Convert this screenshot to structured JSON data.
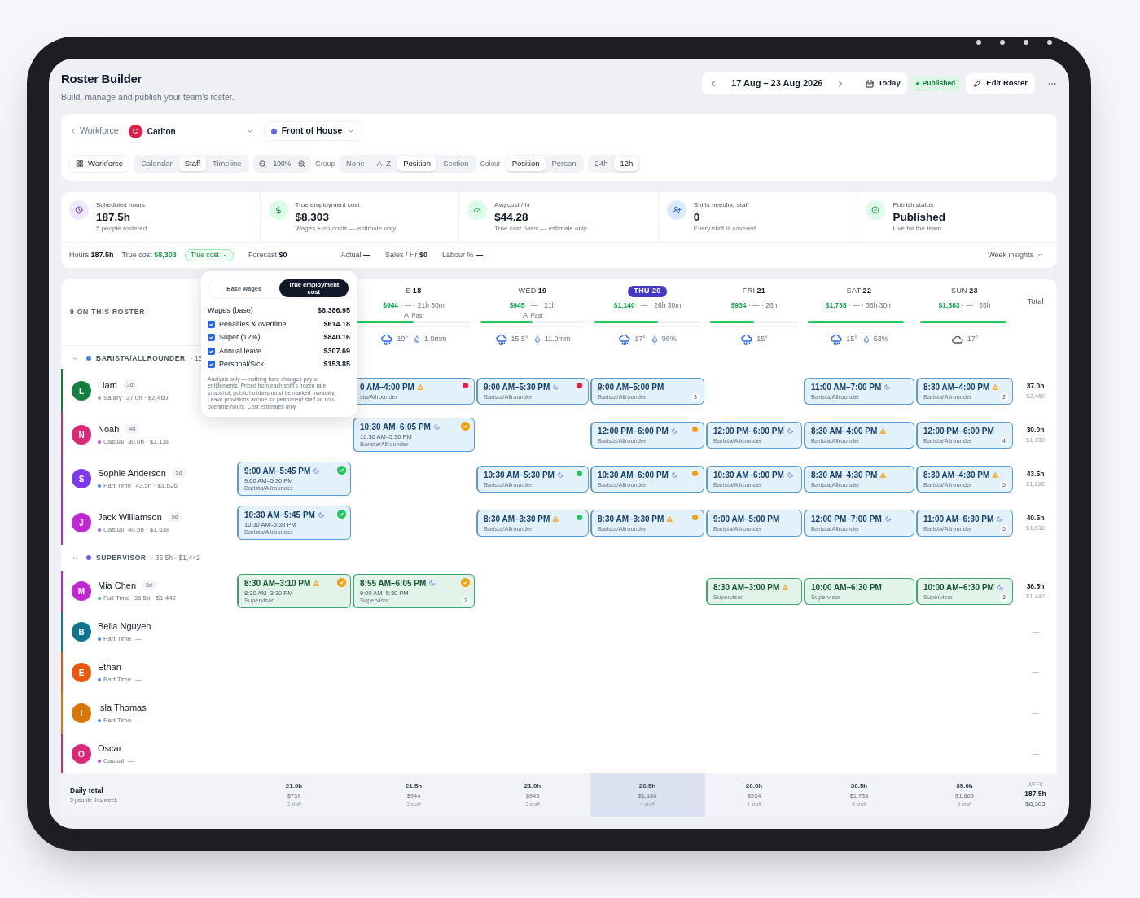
{
  "header": {
    "title": "Roster Builder",
    "subtitle": "Build, manage and publish your team's roster."
  },
  "date_nav": {
    "range": "17 Aug – 23 Aug 2026",
    "today": "Today"
  },
  "status_badge": "Published",
  "edit_button": "Edit Roster",
  "filters": {
    "back_link": "Workforce",
    "location": {
      "initial": "C",
      "name": "Carlton",
      "color": "#e11d48"
    },
    "section": {
      "name": "Front of House",
      "color": "#6366f1"
    },
    "view_button": "Workforce",
    "views": [
      {
        "label": "Calendar",
        "selected": false
      },
      {
        "label": "Staff",
        "selected": true
      },
      {
        "label": "Timeline",
        "selected": false
      }
    ],
    "zoom": "100%",
    "group_label": "Group",
    "group_options": [
      {
        "label": "None",
        "selected": false
      },
      {
        "label": "A–Z",
        "selected": false
      },
      {
        "label": "Position",
        "selected": true
      },
      {
        "label": "Section",
        "selected": false
      }
    ],
    "colour_label": "Colour",
    "colour_options": [
      {
        "label": "Position",
        "selected": true
      },
      {
        "label": "Person",
        "selected": false
      }
    ],
    "clock_options": [
      {
        "label": "24h",
        "selected": false
      },
      {
        "label": "12h",
        "selected": true
      }
    ]
  },
  "stats": [
    {
      "kind": "clock",
      "label": "Scheduled hours",
      "value": "187.5h",
      "note": "5 people rostered"
    },
    {
      "kind": "dollar",
      "label": "True employment cost",
      "value": "$8,303",
      "note": "Wages + on-costs — estimate only"
    },
    {
      "kind": "gauge",
      "label": "Avg cost / hr",
      "value": "$44.28",
      "note": "True cost basis — estimate only"
    },
    {
      "kind": "user",
      "label": "Shifts needing staff",
      "value": "0",
      "note": "Every shift is covered"
    },
    {
      "kind": "check",
      "label": "Publish status",
      "value": "Published",
      "note": "Live for the team"
    }
  ],
  "summary": {
    "hours_label": "Hours",
    "hours": "187.5h",
    "cost_label": "True cost",
    "cost": "$8,303",
    "cost_toggle": {
      "label": "True cost",
      "expanded": true
    },
    "items": [
      {
        "label": "Forecast",
        "value": "$0"
      },
      {
        "label": "Actual",
        "value": "—"
      },
      {
        "label": "Sales / Hr",
        "value": "$0"
      },
      {
        "label": "Labour %",
        "value": "—"
      }
    ],
    "insights": "Week insights"
  },
  "popover": {
    "tabs": [
      {
        "label": "Base wages",
        "selected": false
      },
      {
        "label": "True employment cost",
        "selected": true
      }
    ],
    "lines": [
      {
        "kind": "plain",
        "label": "Wages (base)",
        "value": "$6,386.95"
      },
      {
        "kind": "checkbox",
        "label": "Penalties & overtime",
        "value": "$614.18",
        "checked": true
      },
      {
        "kind": "checkbox",
        "label": "Super (12%)",
        "value": "$840.16",
        "checked": true
      },
      {
        "kind": "checkbox",
        "label": "Annual leave",
        "value": "$307.69",
        "checked": true
      },
      {
        "kind": "checkbox",
        "label": "Personal/Sick",
        "value": "$153.85",
        "checked": true
      }
    ],
    "note": "Analysis only — nothing here changes pay or entitlements. Priced from each shift's frozen rate snapshot; public holidays must be marked manually. Leave provisions accrue for permanent staff on non-overtime hours. Cost estimates only."
  },
  "roster": {
    "count_label": "9 ON THIS ROSTER",
    "total_label": "Total",
    "days": [
      {
        "label": "E",
        "date": "18",
        "cost": "$944",
        "meta": "· — · 21h 30m",
        "past": true,
        "past_label": "Past",
        "level": 0.5,
        "selected": false,
        "weather": {
          "kind": "rain",
          "temp": "19°",
          "precip": "1.9mm"
        }
      },
      {
        "label": "WED",
        "date": "19",
        "cost": "$945",
        "meta": "· — · 21h",
        "past": true,
        "past_label": "Past",
        "level": 0.5,
        "selected": false,
        "weather": {
          "kind": "rain",
          "temp": "15.5°",
          "precip": "11.9mm"
        }
      },
      {
        "label": "THU",
        "date": "20",
        "cost": "$1,140",
        "meta": "· — · 26h 30m",
        "past": false,
        "level": 0.6,
        "selected": true,
        "weather": {
          "kind": "rain",
          "temp": "17°",
          "precip": "96%"
        }
      },
      {
        "label": "FRI",
        "date": "21",
        "cost": "$934",
        "meta": "· — · 26h",
        "past": false,
        "level": 0.5,
        "selected": false,
        "weather": {
          "kind": "rain",
          "temp": "15°"
        }
      },
      {
        "label": "SAT",
        "date": "22",
        "cost": "$1,738",
        "meta": "· — · 36h 30m",
        "past": false,
        "level": 0.94,
        "selected": false,
        "weather": {
          "kind": "rain",
          "temp": "15°",
          "precip": "53%"
        }
      },
      {
        "label": "SUN",
        "date": "23",
        "cost": "$1,863",
        "meta": "· — · 35h",
        "past": false,
        "level": 0.97,
        "selected": false,
        "weather": {
          "kind": "cloud",
          "temp": "17°"
        }
      }
    ],
    "groups": [
      {
        "kind": "barista",
        "name": "BARISTA/ALLROUNDER",
        "meta": "· 15",
        "color": "#3b82f6",
        "expanded": true,
        "staff": [
          {
            "initial": "L",
            "name": "Liam",
            "badge": "3d",
            "color": "#15803d",
            "employment": {
              "type": "Salary",
              "color": "#9ca3af"
            },
            "detail": "37.0h · $2,460",
            "total_hours": "37.0h",
            "total_cost": "$2,460",
            "shifts": [
              {
                "kind": "empty"
              },
              {
                "kind": "early",
                "time": "0 AM–4:00 PM",
                "role": "sta/Allrounder",
                "flag": {
                  "kind": "dot",
                  "color": "#e11d48"
                }
              },
              {
                "kind": "late",
                "time": "9:00 AM–5:30 PM",
                "role": "Barista/Allrounder",
                "flag": {
                  "kind": "dot",
                  "color": "#e11d48"
                }
              },
              {
                "kind": "plain",
                "time": "9:00 AM–5:00 PM",
                "role": "Barista/Allrounder",
                "count": "3"
              },
              {
                "kind": "empty"
              },
              {
                "kind": "late",
                "time": "11:00 AM–7:00 PM",
                "role": "Barista/Allrounder"
              },
              {
                "kind": "early",
                "time": "8:30 AM–4:00 PM",
                "role": "Barista/Allrounder",
                "count": "2"
              }
            ]
          },
          {
            "initial": "N",
            "name": "Noah",
            "badge": "4d",
            "color": "#db2777",
            "employment": {
              "type": "Casual",
              "color": "#a855f7"
            },
            "detail": "30.0h · $1,138",
            "total_hours": "30.0h",
            "total_cost": "$1,138",
            "shifts": [
              {
                "kind": "empty"
              },
              {
                "kind": "late",
                "time": "10:30 AM–6:05 PM",
                "actual": "10:30 AM–5:30 PM",
                "role": "Barista/Allrounder",
                "flag": {
                  "kind": "check",
                  "color": "#f59e0b"
                }
              },
              {
                "kind": "empty"
              },
              {
                "kind": "late",
                "time": "12:00 PM–6:00 PM",
                "role": "Barista/Allrounder",
                "flag": {
                  "kind": "dot",
                  "color": "#f59e0b"
                }
              },
              {
                "kind": "late",
                "time": "12:00 PM–6:00 PM",
                "role": "Barista/Allrounder"
              },
              {
                "kind": "early",
                "time": "8:30 AM–4:00 PM",
                "role": "Barista/Allrounder"
              },
              {
                "kind": "plain",
                "time": "12:00 PM–6:00 PM",
                "role": "Barista/Allrounder",
                "count": "4"
              }
            ]
          },
          {
            "initial": "S",
            "name": "Sophie Anderson",
            "badge": "5d",
            "color": "#7c3aed",
            "employment": {
              "type": "Part Time",
              "color": "#3b82f6"
            },
            "detail": "43.5h · $1,626",
            "total_hours": "43.5h",
            "total_cost": "$1,626",
            "shifts": [
              {
                "kind": "late",
                "time": "9:00 AM–5:45 PM",
                "actual": "9:00 AM–5:30 PM",
                "role": "Barista/Allrounder",
                "flag": {
                  "kind": "check",
                  "color": "#22c55e"
                }
              },
              {
                "kind": "empty"
              },
              {
                "kind": "late",
                "time": "10:30 AM–5:30 PM",
                "role": "Barista/Allrounder",
                "flag": {
                  "kind": "dot",
                  "color": "#22c55e"
                }
              },
              {
                "kind": "late",
                "time": "10:30 AM–6:00 PM",
                "role": "Barista/Allrounder",
                "flag": {
                  "kind": "dot",
                  "color": "#f59e0b"
                }
              },
              {
                "kind": "late",
                "time": "10:30 AM–6:00 PM",
                "role": "Barista/Allrounder"
              },
              {
                "kind": "early",
                "time": "8:30 AM–4:30 PM",
                "role": "Barista/Allrounder"
              },
              {
                "kind": "early",
                "time": "8:30 AM–4:30 PM",
                "role": "Barista/Allrounder",
                "count": "5"
              }
            ]
          },
          {
            "initial": "J",
            "name": "Jack Williamson",
            "badge": "5d",
            "color": "#c026d3",
            "employment": {
              "type": "Casual",
              "color": "#a855f7"
            },
            "detail": "40.5h · $1,638",
            "total_hours": "40.5h",
            "total_cost": "$1,638",
            "shifts": [
              {
                "kind": "late",
                "time": "10:30 AM–5:45 PM",
                "actual": "10:30 AM–5:30 PM",
                "role": "Barista/Allrounder",
                "flag": {
                  "kind": "check",
                  "color": "#22c55e"
                }
              },
              {
                "kind": "empty"
              },
              {
                "kind": "early",
                "time": "8:30 AM–3:30 PM",
                "role": "Barista/Allrounder",
                "flag": {
                  "kind": "dot",
                  "color": "#22c55e"
                }
              },
              {
                "kind": "early",
                "time": "8:30 AM–3:30 PM",
                "role": "Barista/Allrounder",
                "flag": {
                  "kind": "dot",
                  "color": "#f59e0b"
                }
              },
              {
                "kind": "plain",
                "time": "9:00 AM–5:00 PM",
                "role": "Barista/Allrounder"
              },
              {
                "kind": "late",
                "time": "12:00 PM–7:00 PM",
                "role": "Barista/Allrounder"
              },
              {
                "kind": "late",
                "time": "11:00 AM–6:30 PM",
                "role": "Barista/Allrounder",
                "count": "5"
              }
            ]
          }
        ]
      },
      {
        "kind": "supervisor",
        "name": "SUPERVISOR",
        "meta": "· 36.5h · $1,442",
        "color": "#6366f1",
        "expanded": true,
        "staff": [
          {
            "initial": "M",
            "name": "Mia Chen",
            "badge": "3d",
            "color": "#c026d3",
            "employment": {
              "type": "Full Time",
              "color": "#22c55e"
            },
            "detail": "36.5h · $1,442",
            "total_hours": "36.5h",
            "total_cost": "$1,442",
            "shifts": [
              {
                "kind": "early",
                "time": "8:30 AM–3:10 PM",
                "actual": "8:30 AM–3:30 PM",
                "role": "Supervisor",
                "flag": {
                  "kind": "check",
                  "color": "#f59e0b"
                }
              },
              {
                "kind": "late",
                "time": "8:55 AM–6:05 PM",
                "actual": "9:00 AM–5:30 PM",
                "role": "Supervisor",
                "flag": {
                  "kind": "check",
                  "color": "#f59e0b"
                },
                "count": "2"
              },
              {
                "kind": "empty"
              },
              {
                "kind": "empty"
              },
              {
                "kind": "early",
                "time": "8:30 AM–3:00 PM",
                "role": "Supervisor"
              },
              {
                "kind": "plain",
                "time": "10:00 AM–6:30 PM",
                "role": "Supervisor"
              },
              {
                "kind": "late",
                "time": "10:00 AM–6:30 PM",
                "role": "Supervisor",
                "count": "3"
              }
            ]
          },
          {
            "initial": "B",
            "name": "Bella Nguyen",
            "color": "#0e7490",
            "employment": {
              "type": "Part Time",
              "color": "#3b82f6"
            },
            "detail": "—",
            "total_hours": "—"
          },
          {
            "initial": "E",
            "name": "Ethan",
            "color": "#ea580c",
            "employment": {
              "type": "Part Time",
              "color": "#3b82f6"
            },
            "detail": "—",
            "total_hours": "—"
          },
          {
            "initial": "I",
            "name": "Isla Thomas",
            "color": "#d97706",
            "employment": {
              "type": "Part Time",
              "color": "#3b82f6"
            },
            "detail": "—",
            "total_hours": "—"
          },
          {
            "initial": "O",
            "name": "Oscar",
            "color": "#db2777",
            "employment": {
              "type": "Casual",
              "color": "#a855f7"
            },
            "detail": "—",
            "total_hours": "—"
          }
        ]
      }
    ],
    "daily_total": {
      "label": "Daily total",
      "note": "5 people this week",
      "days": [
        {
          "hours": "21.0h",
          "cost": "$739",
          "staff": "3 staff",
          "selected": false
        },
        {
          "hours": "21.5h",
          "cost": "$944",
          "staff": "3 staff",
          "selected": false
        },
        {
          "hours": "21.0h",
          "cost": "$945",
          "staff": "3 staff",
          "selected": false
        },
        {
          "hours": "26.5h",
          "cost": "$1,140",
          "staff": "4 staff",
          "selected": true
        },
        {
          "hours": "26.0h",
          "cost": "$934",
          "staff": "4 staff",
          "selected": false
        },
        {
          "hours": "36.5h",
          "cost": "$1,738",
          "staff": "5 staff",
          "selected": false
        },
        {
          "hours": "35.0h",
          "cost": "$1,863",
          "staff": "5 staff",
          "selected": false
        }
      ],
      "week_label": "WEEK",
      "week_hours": "187.5h",
      "week_cost": "$8,303"
    }
  }
}
